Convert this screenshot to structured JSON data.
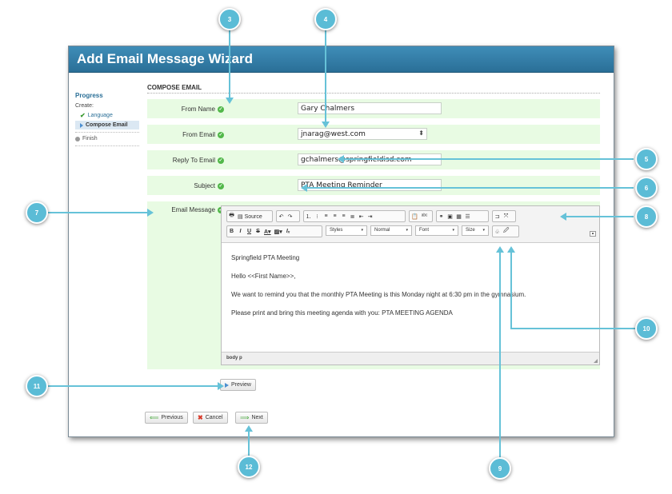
{
  "window": {
    "title": "Add Email Message Wizard"
  },
  "sidebar": {
    "progress_title": "Progress",
    "create_label": "Create:",
    "steps": [
      {
        "label": "Language",
        "state": "done"
      },
      {
        "label": "Compose Email",
        "state": "current"
      },
      {
        "label": "Finish",
        "state": "pending"
      }
    ]
  },
  "form": {
    "section_title": "COMPOSE EMAIL",
    "from_name": {
      "label": "From Name",
      "value": "Gary Chalmers"
    },
    "from_email": {
      "label": "From Email",
      "value": "jnarag@west.com"
    },
    "reply_to": {
      "label": "Reply To Email",
      "value": "gchalmers@springfieldisd.com"
    },
    "subject": {
      "label": "Subject",
      "value": "PTA Meeting Reminder"
    },
    "message_label": "Email Message"
  },
  "editor": {
    "toolbar": {
      "source_label": "Source",
      "styles": "Styles",
      "format": "Normal",
      "font": "Font",
      "size": "Size"
    },
    "content": [
      "Springfield PTA Meeting",
      "Hello <<First Name>>,",
      "We want to remind you that the monthly PTA Meeting is this Monday night at 6:30 pm in the gymnasium.",
      "Please print and bring this meeting agenda with you: PTA MEETING AGENDA"
    ],
    "status_path": "body  p"
  },
  "buttons": {
    "preview": "Preview",
    "previous": "Previous",
    "cancel": "Cancel",
    "next": "Next"
  },
  "callouts": [
    "3",
    "4",
    "5",
    "6",
    "7",
    "8",
    "9",
    "10",
    "11",
    "12"
  ],
  "colors": {
    "titlebar": "#2f7ea8",
    "row_bg": "#e8fbe3",
    "callout": "#5bbcd6",
    "check": "#52b84a"
  }
}
